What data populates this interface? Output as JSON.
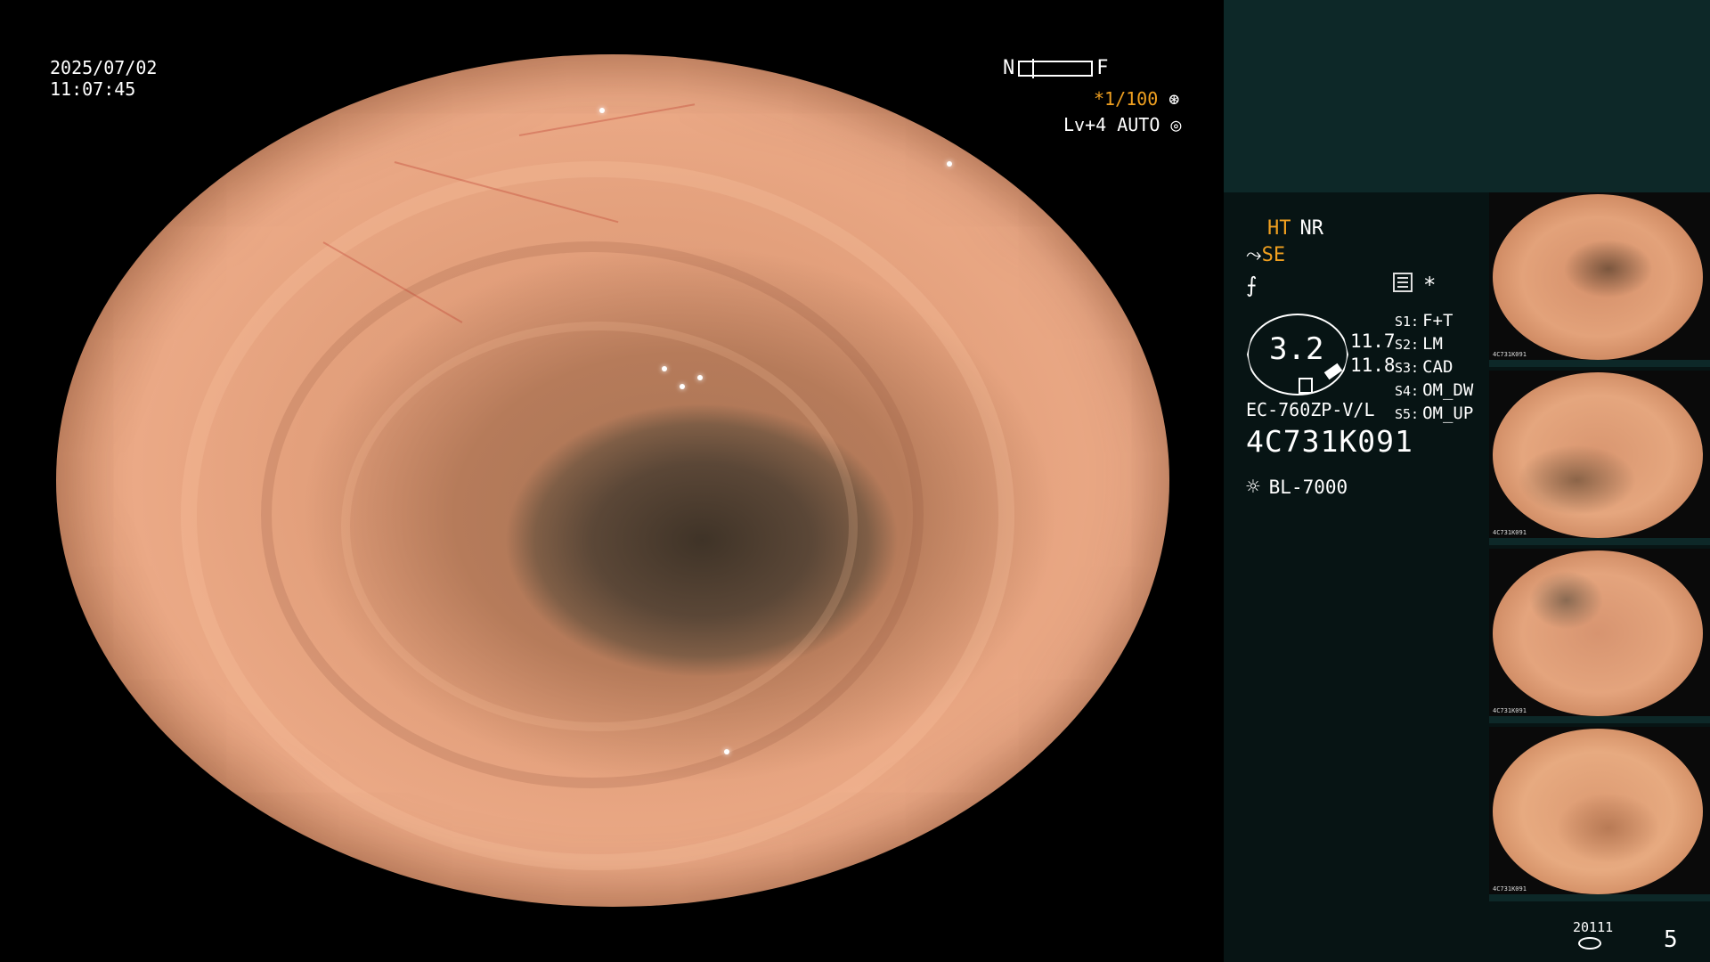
{
  "overlay": {
    "date": "2025/07/02",
    "time": "11:07:45",
    "near_label": "N",
    "far_label": "F",
    "shutter": "*1/100",
    "level": "Lv+4 AUTO"
  },
  "panel": {
    "ht": "HT",
    "nr": "NR",
    "se": "SE",
    "star": "*",
    "gauge_value": "3.2",
    "reading_1": "11.7",
    "reading_2": "11.8",
    "settings": [
      {
        "key": "S1:",
        "value": "F+T"
      },
      {
        "key": "S2:",
        "value": "LM"
      },
      {
        "key": "S3:",
        "value": "CAD"
      },
      {
        "key": "S4:",
        "value": "OM_DW"
      },
      {
        "key": "S5:",
        "value": "OM_UP"
      }
    ],
    "scope_model": "EC-760ZP-V/L",
    "serial": "4C731K091",
    "light_source": "BL-7000"
  },
  "thumbnails": [
    {
      "tag": "4C731K091"
    },
    {
      "tag": "4C731K091"
    },
    {
      "tag": "4C731K091"
    },
    {
      "tag": "4C731K091"
    }
  ],
  "footer": {
    "code": "20111",
    "count": "5"
  },
  "colors": {
    "accent": "#f0a020",
    "panel_bg": "#071414",
    "panel_top": "#0d2828"
  }
}
